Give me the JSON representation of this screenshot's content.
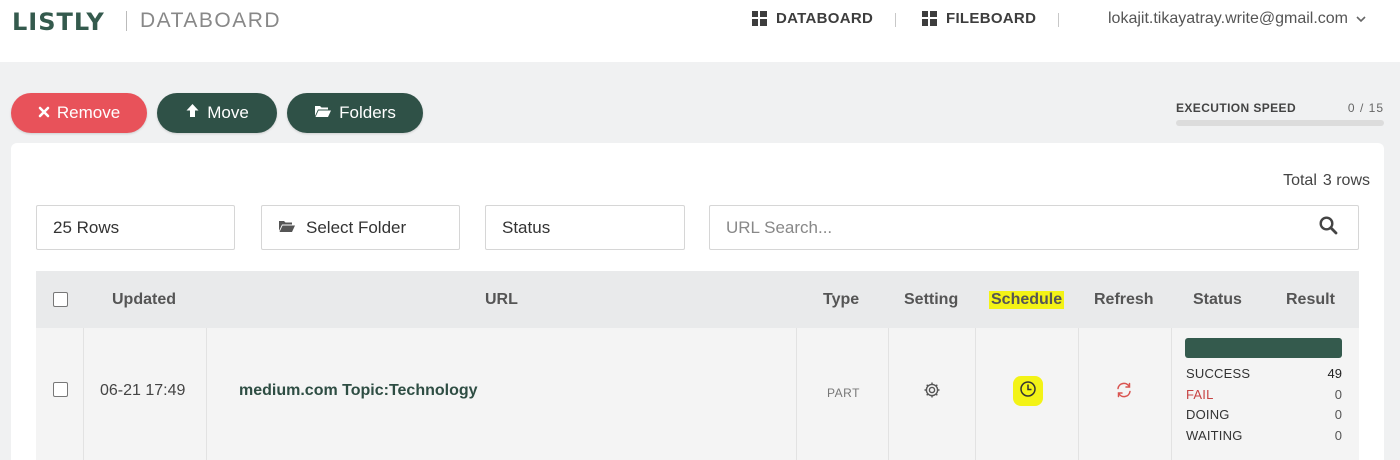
{
  "brand": {
    "logo": "LISTLY",
    "subtitle": "DATABOARD"
  },
  "nav": {
    "databoard": "DATABOARD",
    "fileboard": "FILEBOARD",
    "user_email": "lokajit.tikayatray.write@gmail.com"
  },
  "actions": {
    "remove": "Remove",
    "move": "Move",
    "folders": "Folders"
  },
  "execution_speed": {
    "label": "EXECUTION SPEED",
    "current": "0",
    "sep": "/",
    "max": "15"
  },
  "summary": {
    "total_label": "Total",
    "total_value": "3 rows"
  },
  "filters": {
    "rows": "25 Rows",
    "folder": "Select Folder",
    "status": "Status",
    "search_placeholder": "URL Search..."
  },
  "table": {
    "headers": {
      "updated": "Updated",
      "url": "URL",
      "type": "Type",
      "setting": "Setting",
      "schedule": "Schedule",
      "refresh": "Refresh",
      "status": "Status",
      "result": "Result"
    },
    "rows": [
      {
        "updated": "06-21 17:49",
        "url": "medium.com Topic:Technology",
        "type": "PART",
        "status": {
          "success_label": "SUCCESS",
          "success": "49",
          "fail_label": "FAIL",
          "fail": "0",
          "doing_label": "DOING",
          "doing": "0",
          "waiting_label": "WAITING",
          "waiting": "0"
        }
      }
    ]
  },
  "colors": {
    "brand_green": "#2f5147",
    "remove_red": "#e8525a",
    "highlight_yellow": "#f3f316",
    "fail_red": "#c74444"
  },
  "icons": {
    "databoard": "grid-icon",
    "fileboard": "grid-icon",
    "user_menu": "chevron-down-icon",
    "remove": "close-icon",
    "move": "arrow-up-icon",
    "folders": "folder-open-icon",
    "search": "search-icon",
    "setting": "gear-icon",
    "schedule": "clock-icon",
    "refresh": "refresh-icon"
  }
}
